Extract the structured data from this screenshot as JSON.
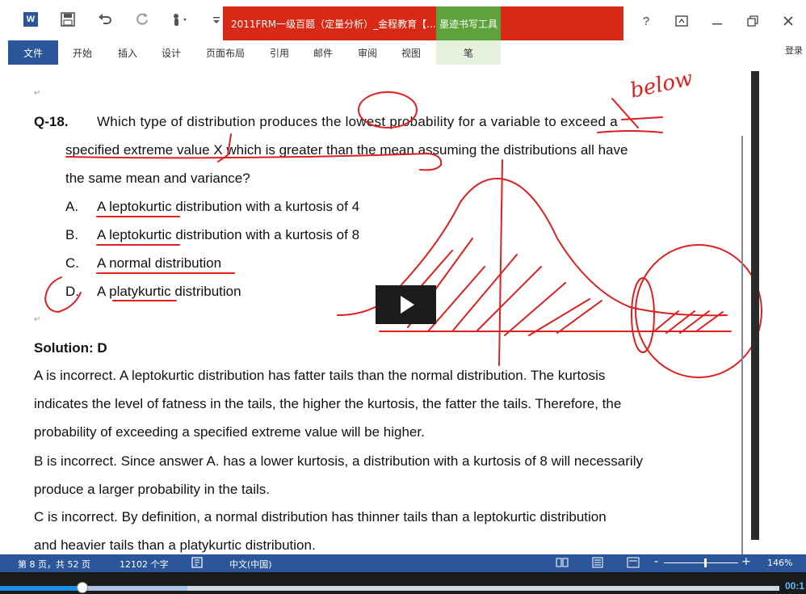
{
  "titlebar": {
    "doc_title": "2011FRM一级百题（定量分析）_金程教育【...",
    "ink_tools": "墨迹书写工具",
    "help": "?",
    "word_logo": "W"
  },
  "ribbon": {
    "tabs": [
      "文件",
      "开始",
      "插入",
      "设计",
      "页面布局",
      "引用",
      "邮件",
      "审阅",
      "视图",
      "笔"
    ],
    "login": "登录"
  },
  "question": {
    "number": "Q-18.",
    "line1": "Which type of distribution produces the lowest probability for a variable to exceed a",
    "line2": "specified extreme value X which is greater than the mean assuming the distributions all have",
    "line3": "the same mean and variance?",
    "options": [
      {
        "letter": "A.",
        "text": "A leptokurtic distribution with a kurtosis of 4"
      },
      {
        "letter": "B.",
        "text": "A leptokurtic distribution with a kurtosis of 8"
      },
      {
        "letter": "C.",
        "text": "A normal distribution"
      },
      {
        "letter": "D.",
        "text": "A platykurtic distribution"
      }
    ]
  },
  "solution": {
    "heading": "Solution: D",
    "lines": [
      "A is incorrect. A leptokurtic distribution has fatter tails than the normal distribution. The kurtosis",
      "indicates the level of fatness in the tails, the higher the kurtosis, the fatter the tails. Therefore, the",
      "probability of exceeding a specified extreme value will be higher.",
      "B is incorrect. Since answer A. has a lower kurtosis, a distribution with a kurtosis of 8 will necessarily",
      "produce a larger probability in the tails.",
      "C is incorrect. By definition, a normal distribution has thinner tails than a leptokurtic distribution",
      "and heavier tails than a platykurtic distribution."
    ]
  },
  "annotation": {
    "handwriting": "below"
  },
  "statusbar": {
    "page": "第 8 页，共 52 页",
    "words": "12102 个字",
    "language": "中文(中国)",
    "zoom": "146%"
  },
  "player": {
    "time": "00:1",
    "progress": 0.105,
    "buffered": 0.24
  },
  "colors": {
    "word_blue": "#2b579a",
    "title_red": "#d72915",
    "ink_green": "#5da23a",
    "annotation_red": "#e02020",
    "progress_blue": "#1a8fe3"
  }
}
